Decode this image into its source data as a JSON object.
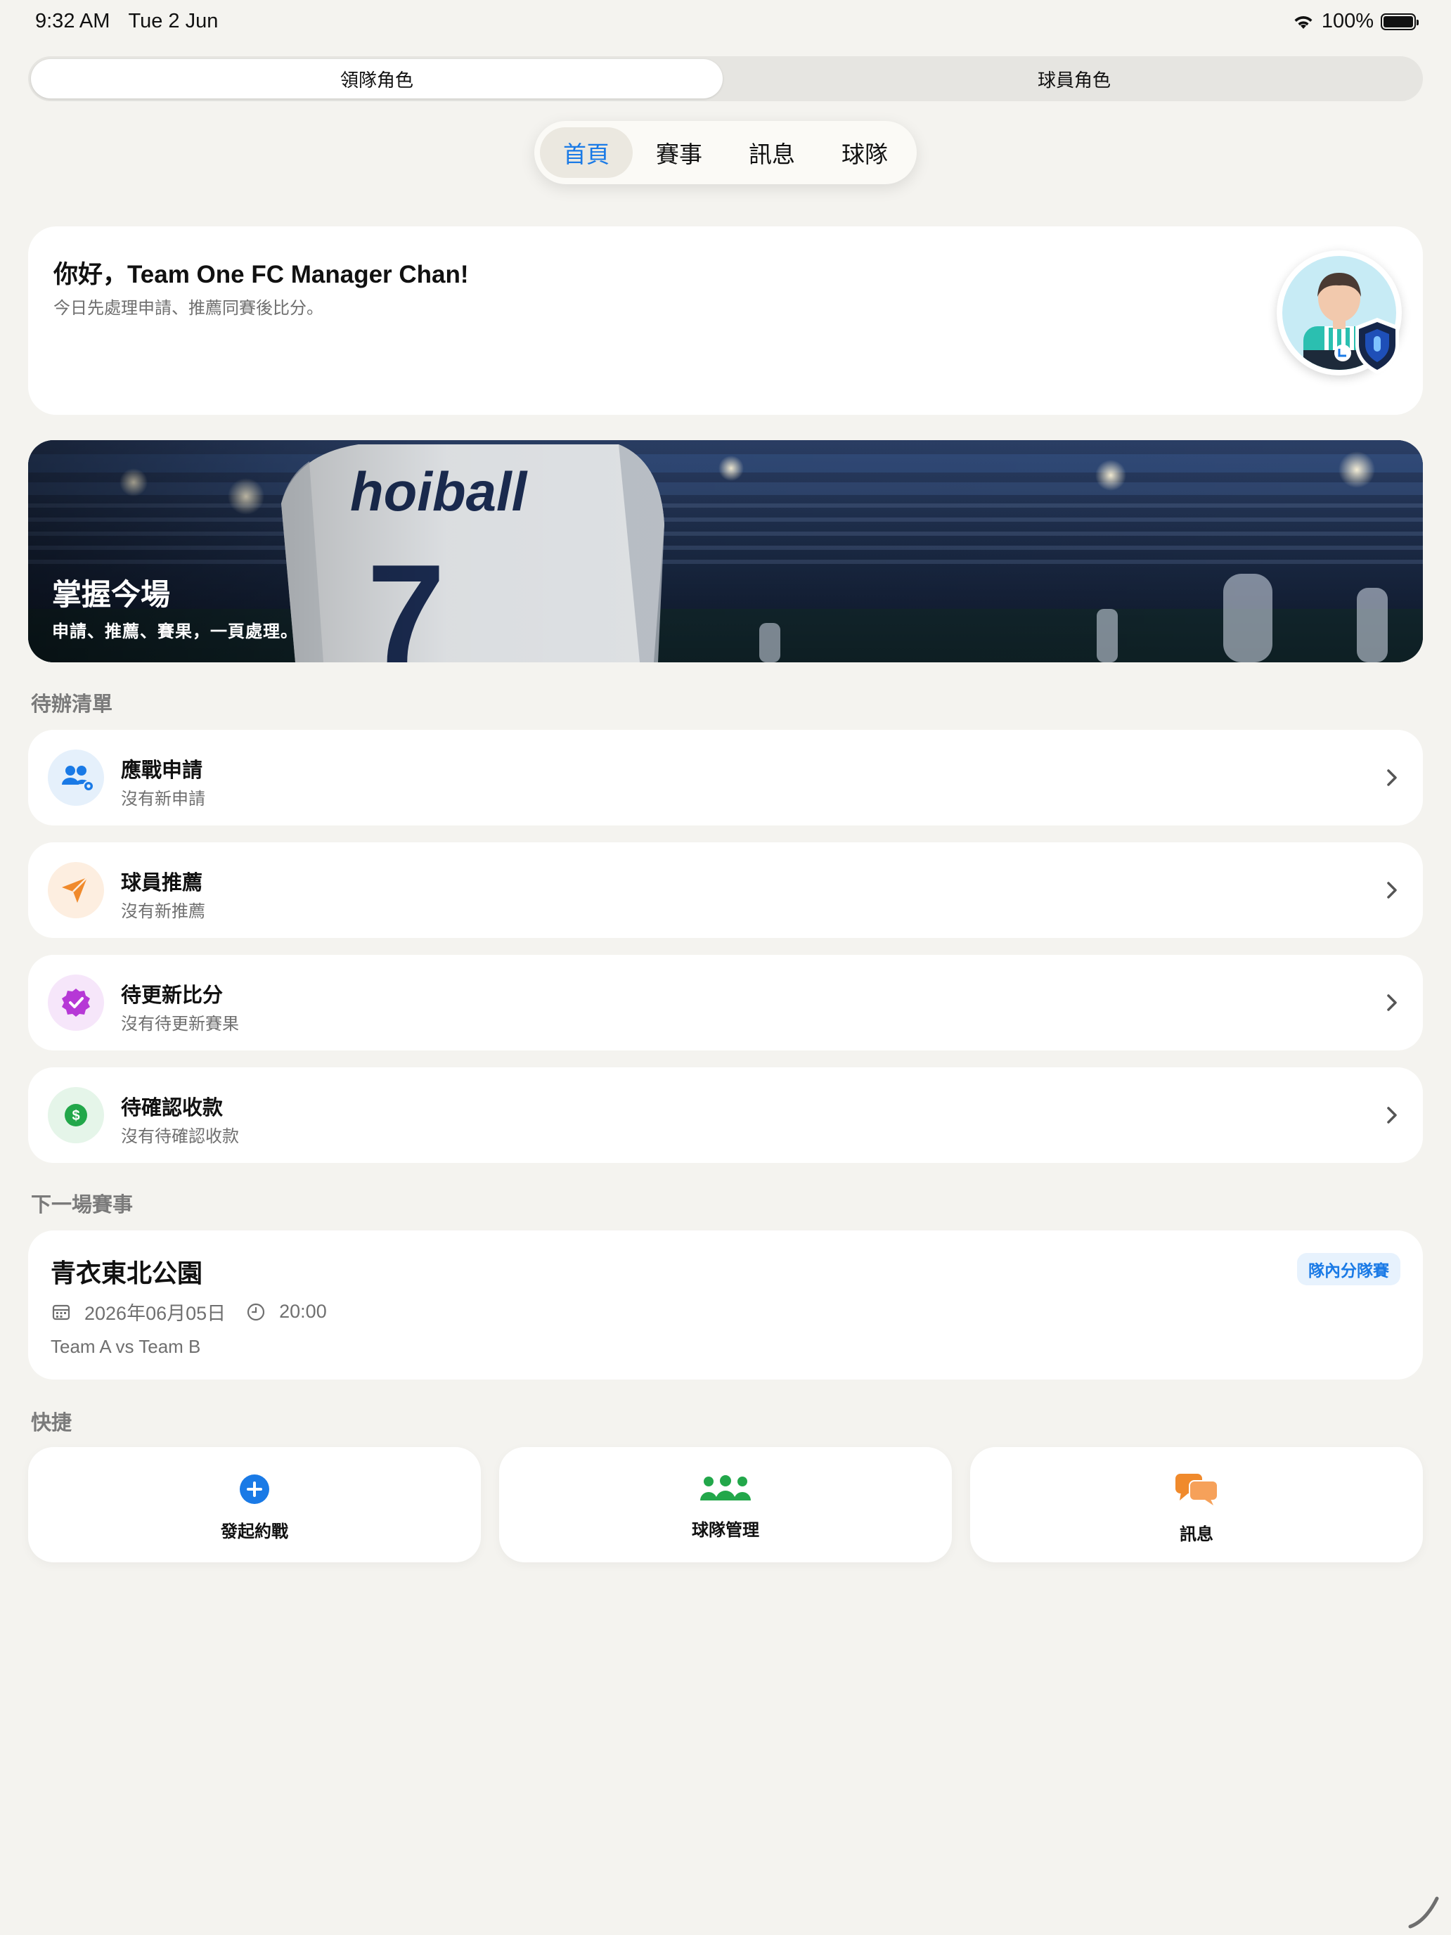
{
  "status": {
    "time": "9:32 AM",
    "date": "Tue 2 Jun",
    "battery": "100%"
  },
  "role_switch": {
    "active": "領隊角色",
    "inactive": "球員角色"
  },
  "nav": {
    "tabs": [
      "首頁",
      "賽事",
      "訊息",
      "球隊"
    ],
    "active_index": 0
  },
  "greeting": {
    "title": "你好，Team One FC Manager Chan!",
    "subtitle": "今日先處理申請、推薦同賽後比分。"
  },
  "hero": {
    "jersey_brand": "hoiball",
    "jersey_number": "7",
    "title": "掌握今場",
    "subtitle": "申請、推薦、賽果，一頁處理。"
  },
  "todo": {
    "label": "待辦清單",
    "items": [
      {
        "title": "應戰申請",
        "subtitle": "沒有新申請",
        "icon": "people-gear-icon",
        "color": "#1a7ae6",
        "bg": "#e5f0fb"
      },
      {
        "title": "球員推薦",
        "subtitle": "沒有新推薦",
        "icon": "paper-plane-icon",
        "color": "#f08a2c",
        "bg": "#fdeee0"
      },
      {
        "title": "待更新比分",
        "subtitle": "沒有待更新賽果",
        "icon": "verified-badge-icon",
        "color": "#b638d6",
        "bg": "#f6e6fa"
      },
      {
        "title": "待確認收款",
        "subtitle": "沒有待確認收款",
        "icon": "dollar-circle-icon",
        "color": "#22a74a",
        "bg": "#e5f5e9"
      }
    ]
  },
  "next_match": {
    "label": "下一場賽事",
    "venue": "青衣東北公園",
    "badge": "隊內分隊賽",
    "date": "2026年06月05日",
    "time": "20:00",
    "teams": "Team A vs Team B"
  },
  "quick": {
    "label": "快捷",
    "items": [
      {
        "label": "發起約戰",
        "icon": "plus-circle-icon",
        "color": "#1a7ae6"
      },
      {
        "label": "球隊管理",
        "icon": "group-icon",
        "color": "#22a74a"
      },
      {
        "label": "訊息",
        "icon": "chat-bubbles-icon",
        "color": "#f08a2c"
      }
    ]
  }
}
